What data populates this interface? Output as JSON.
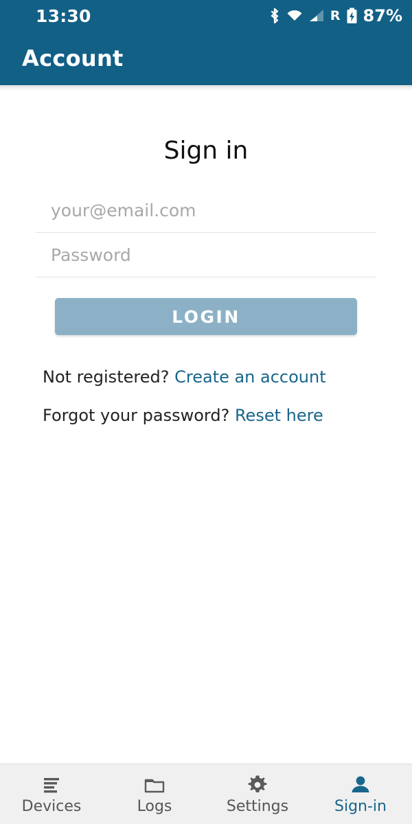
{
  "status_bar": {
    "time": "13:30",
    "battery_percent": "87%",
    "roaming_indicator": "R",
    "icons": [
      "bluetooth-icon",
      "wifi-icon",
      "cellular-signal-icon",
      "roaming-icon",
      "battery-charging-icon"
    ]
  },
  "header": {
    "title": "Account",
    "background_color": "#136086",
    "text_color": "#ffffff"
  },
  "form": {
    "title": "Sign in",
    "email": {
      "placeholder": "your@email.com",
      "value": ""
    },
    "password": {
      "placeholder": "Password",
      "value": ""
    },
    "login_label": "LOGIN",
    "login_color": "#8cb1c7"
  },
  "links": {
    "register_prompt": "Not registered?",
    "register_link": "Create an account",
    "forgot_prompt": "Forgot your password?",
    "forgot_link": "Reset here",
    "link_color": "#19668c"
  },
  "bottom_nav": {
    "active_index": 3,
    "items": [
      {
        "label": "Devices",
        "icon": "list-lines-icon"
      },
      {
        "label": "Logs",
        "icon": "folder-icon"
      },
      {
        "label": "Settings",
        "icon": "gear-icon"
      },
      {
        "label": "Sign-in",
        "icon": "person-icon"
      }
    ]
  }
}
